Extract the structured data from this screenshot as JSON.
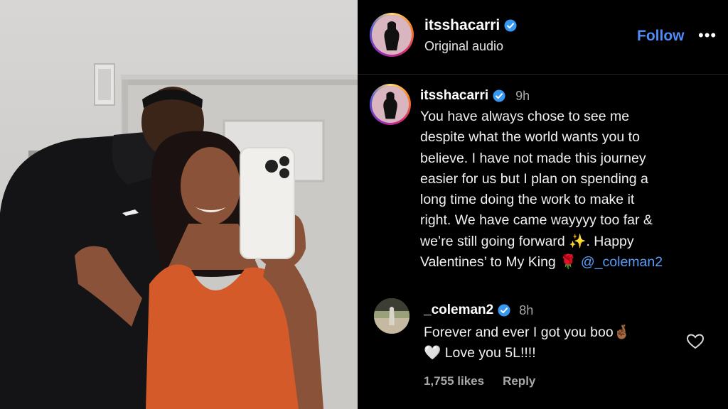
{
  "header": {
    "username": "itsshacarri",
    "subtitle": "Original audio",
    "follow_label": "Follow",
    "more_label": "•••"
  },
  "caption": {
    "username": "itsshacarri",
    "time": "9h",
    "lines": [
      "You have always chose to see me",
      "despite what the world wants you to",
      "believe. I have not made this journey",
      "easier for us but I plan on spending a",
      "long time doing the work to make it",
      "right. We have came wayyyy too far &",
      "we’re still going forward ✨. Happy",
      "Valentines’ to My King 🌹 "
    ],
    "mention": "@_coleman2"
  },
  "comment": {
    "username": "_coleman2",
    "time": "8h",
    "lines": [
      "Forever and ever I got you boo🤞🏾",
      "🤍 Love you 5L!!!!"
    ],
    "likes": "1,755 likes",
    "reply_label": "Reply"
  },
  "colors": {
    "link": "#4f8cf7",
    "verified": "#3897f0",
    "shirt": "#d45a2a"
  },
  "icons": [
    "verified-badge-icon",
    "heart-outline-icon",
    "more-options-icon"
  ]
}
